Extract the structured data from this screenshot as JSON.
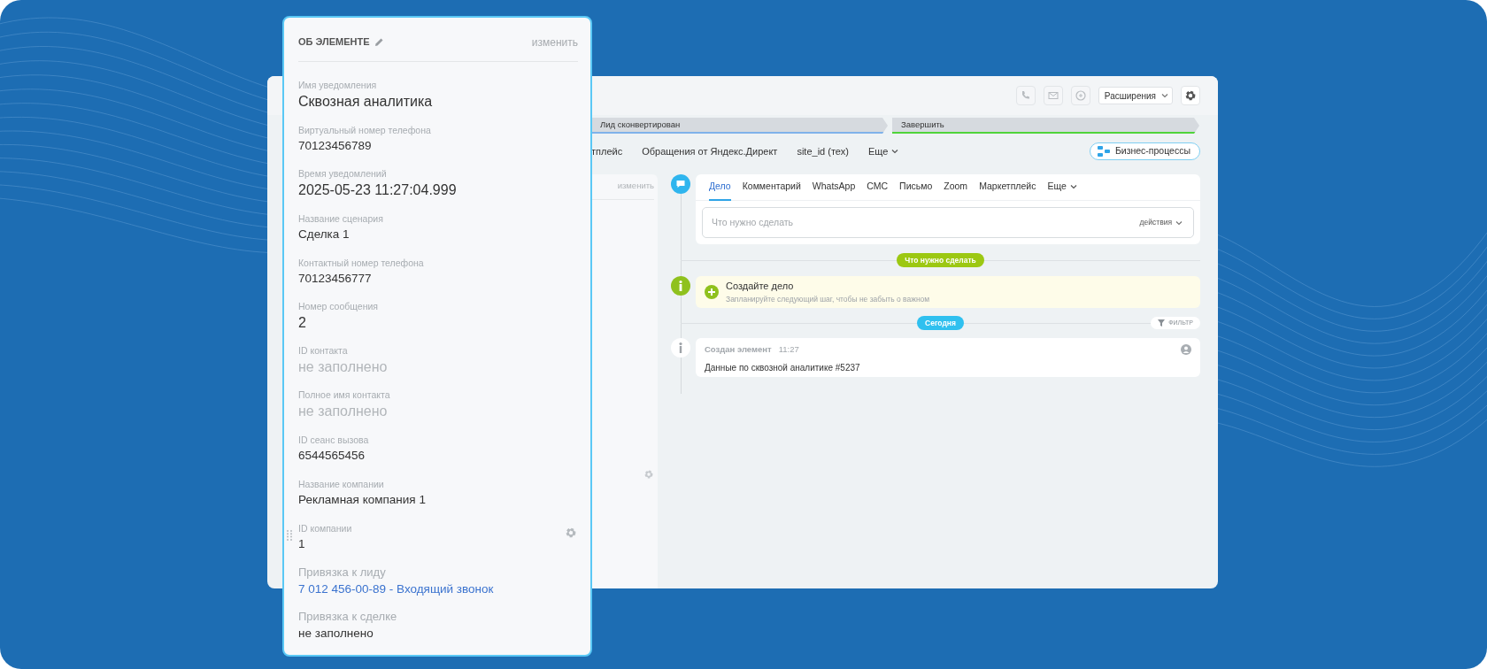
{
  "panel": {
    "title": "ОБ ЭЛЕМЕНТЕ",
    "edit_link": "изменить",
    "fields": [
      {
        "label": "Имя уведомления",
        "value": "Сквозная аналитика",
        "kind": "large"
      },
      {
        "label": "Виртуальный номер телефона",
        "value": "70123456789",
        "kind": "text"
      },
      {
        "label": "Время уведомлений",
        "value": "2025-05-23 11:27:04.999",
        "kind": "large"
      },
      {
        "label": "Название сценария",
        "value": "Сделка 1",
        "kind": "text"
      },
      {
        "label": "Контактный номер телефона",
        "value": "70123456777",
        "kind": "text"
      },
      {
        "label": "Номер сообщения",
        "value": "2",
        "kind": "large"
      },
      {
        "label": "ID контакта",
        "value": "не заполнено",
        "kind": "empty"
      },
      {
        "label": "Полное имя контакта",
        "value": "не заполнено",
        "kind": "empty"
      },
      {
        "label": "ID сеанс вызова",
        "value": "6544565456",
        "kind": "text"
      },
      {
        "label": "Название компании",
        "value": "Рекламная компания 1",
        "kind": "text"
      },
      {
        "label": "ID компании",
        "value": "1",
        "kind": "hover"
      },
      {
        "label": "Привязка к лиду",
        "value": "7 012 456-00-89 - Входящий звонок",
        "kind": "link"
      },
      {
        "label": "Привязка к сделке",
        "value": "не заполнено",
        "kind": "binding"
      }
    ]
  },
  "window": {
    "extensions": "Расширения",
    "stages": [
      {
        "label": "Лид сконвертирован",
        "color": "#7fb2ea"
      },
      {
        "label": "Завершить",
        "color": "#4fd43a"
      }
    ],
    "tabs": [
      {
        "label": "тплейс",
        "kind": "plain"
      },
      {
        "label": "Обращения от Яндекс.Директ",
        "kind": "plain"
      },
      {
        "label": "site_id (тех)",
        "kind": "plain"
      },
      {
        "label": "Еще",
        "kind": "more"
      }
    ],
    "bp_button": "Бизнес-процессы",
    "side_card": {
      "edit_link": "изменить"
    },
    "timeline": {
      "editor_tabs": [
        {
          "label": "Дело",
          "kind": "plain",
          "selected": true
        },
        {
          "label": "Комментарий",
          "kind": "plain",
          "selected": false
        },
        {
          "label": "WhatsApp",
          "kind": "plain",
          "selected": false
        },
        {
          "label": "СМС",
          "kind": "plain",
          "selected": false
        },
        {
          "label": "Письмо",
          "kind": "plain",
          "selected": false
        },
        {
          "label": "Zoom",
          "kind": "plain",
          "selected": false
        },
        {
          "label": "Маркетплейс",
          "kind": "plain",
          "selected": false
        },
        {
          "label": "Еще",
          "kind": "more",
          "selected": false
        }
      ],
      "input_placeholder": "Что нужно сделать",
      "actions": "действия",
      "todo_pill": "Что нужно сделать",
      "todo_card": {
        "title": "Создайте дело",
        "subtitle": "Запланируйте следующий шаг, чтобы не забыть о важном"
      },
      "today_pill": "Сегодня",
      "filter": "ФИЛЬТР",
      "event": {
        "title": "Создан элемент",
        "time": "11:27",
        "text": "Данные по сквозной аналитике #5237"
      }
    }
  }
}
